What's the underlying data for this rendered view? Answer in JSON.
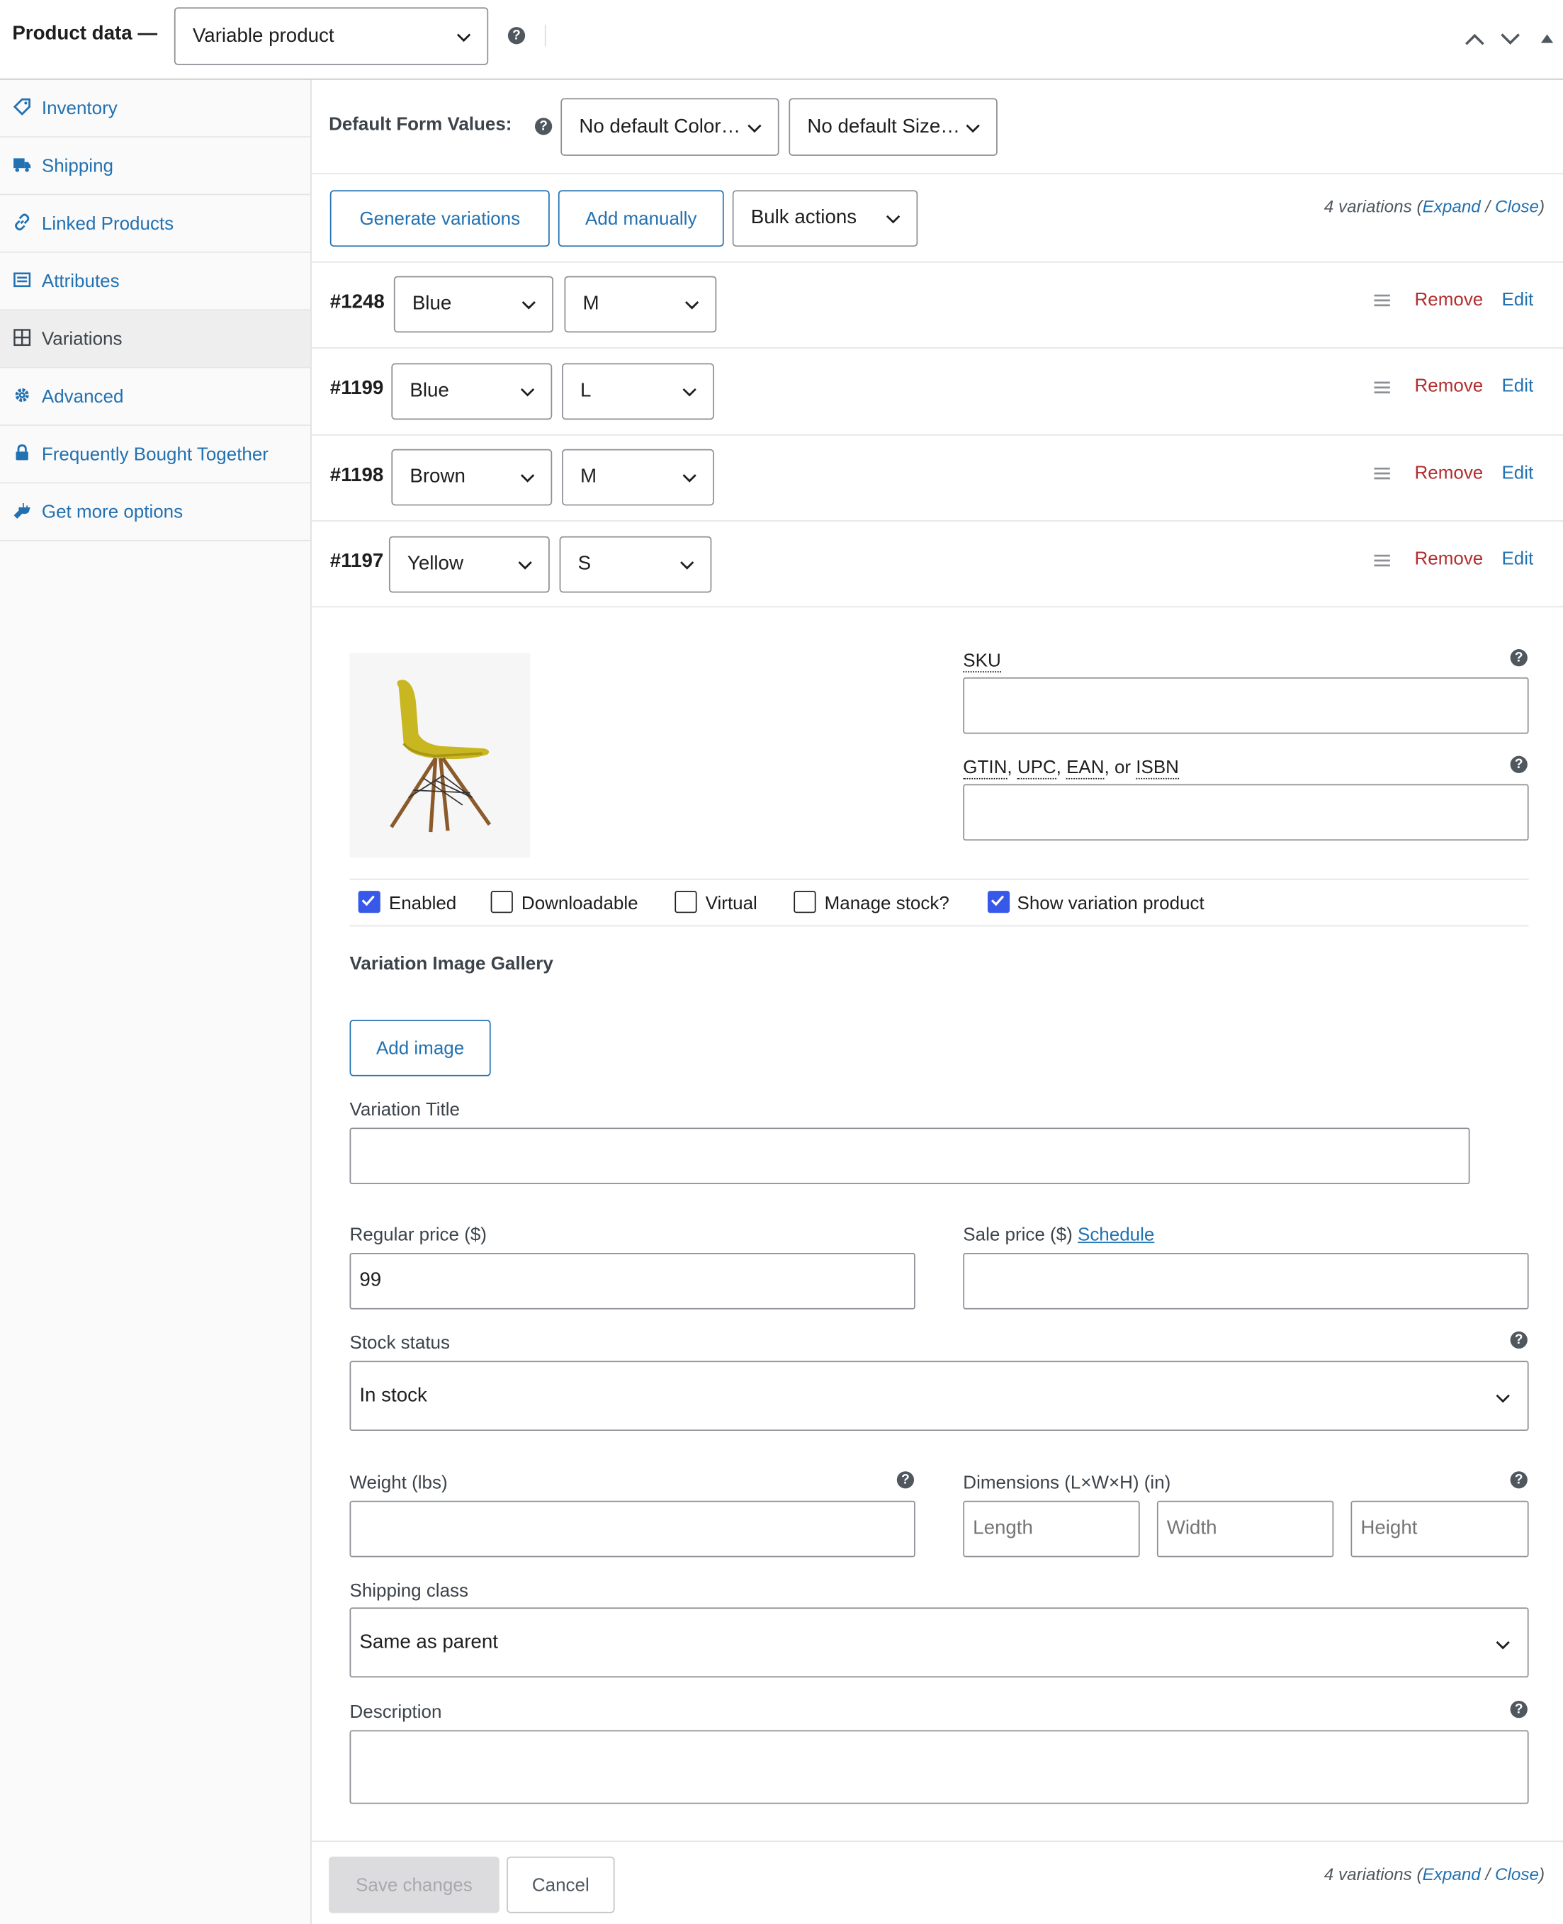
{
  "header": {
    "title": "Product data —",
    "product_type": "Variable product"
  },
  "sidebar": {
    "items": [
      {
        "label": "Inventory"
      },
      {
        "label": "Shipping"
      },
      {
        "label": "Linked Products"
      },
      {
        "label": "Attributes"
      },
      {
        "label": "Variations"
      },
      {
        "label": "Advanced"
      },
      {
        "label": "Frequently Bought Together"
      },
      {
        "label": "Get more options"
      }
    ]
  },
  "defaults": {
    "label": "Default Form Values:",
    "color": "No default Color…",
    "size": "No default Size…"
  },
  "toolbar": {
    "generate": "Generate variations",
    "add_manually": "Add manually",
    "bulk": "Bulk actions",
    "count": "4 variations (",
    "expand": "Expand",
    "sep": " / ",
    "close": "Close",
    "end": ")"
  },
  "variations": [
    {
      "id": "#1248",
      "color": "Blue",
      "size": "M"
    },
    {
      "id": "#1199",
      "color": "Blue",
      "size": "L"
    },
    {
      "id": "#1198",
      "color": "Brown",
      "size": "M"
    },
    {
      "id": "#1197",
      "color": "Yellow",
      "size": "S"
    }
  ],
  "actions": {
    "remove": "Remove",
    "edit": "Edit"
  },
  "detail": {
    "sku_label": "SKU",
    "gtin_label_1": "GTIN",
    "gtin_label_2": "UPC",
    "gtin_label_3": "EAN",
    "gtin_label_4": "ISBN",
    "gtin_sep": ", ",
    "gtin_or": ", or ",
    "enabled": "Enabled",
    "downloadable": "Downloadable",
    "virtual": "Virtual",
    "manage_stock": "Manage stock?",
    "show_variation": "Show variation product",
    "gallery_title": "Variation Image Gallery",
    "add_image": "Add image",
    "title_label": "Variation Title",
    "regular_price_label": "Regular price ($)",
    "regular_price": "99",
    "sale_price_label": "Sale price ($)",
    "schedule": "Schedule",
    "stock_label": "Stock status",
    "stock_value": "In stock",
    "weight_label": "Weight (lbs)",
    "dimensions_label": "Dimensions (L×W×H) (in)",
    "length_ph": "Length",
    "width_ph": "Width",
    "height_ph": "Height",
    "shipping_label": "Shipping class",
    "shipping_value": "Same as parent",
    "description_label": "Description"
  },
  "footer": {
    "save": "Save changes",
    "cancel": "Cancel"
  },
  "colors": {
    "accent": "#2271b1",
    "remove": "#b32d2e",
    "checkbox": "#3858e9"
  }
}
